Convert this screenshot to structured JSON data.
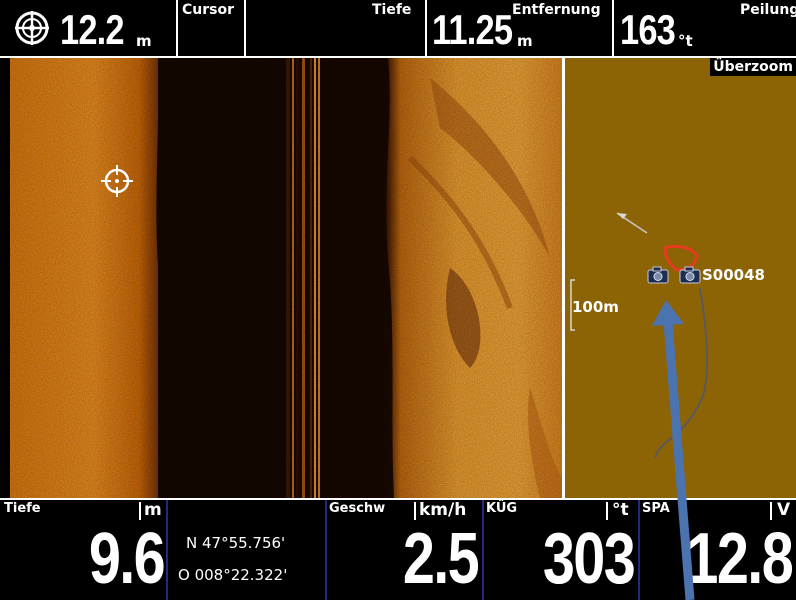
{
  "topbar": {
    "depth_value": "12.2",
    "depth_unit": "m",
    "cursor_label": "Cursor",
    "tiefe_label": "Tiefe",
    "cursor_depth_value": "11.25",
    "cursor_depth_unit": "m",
    "entfernung_label": "Entfernung",
    "bearing_value": "163",
    "bearing_unit": "°t",
    "peilung_label": "Peilung"
  },
  "map": {
    "overzoom_label": "Überzoom",
    "scale_label": "100m",
    "waypoint_label": "S00048",
    "colors": {
      "land": "#8c6406",
      "track": "#5a5a5a",
      "boat": "#e53b1f"
    }
  },
  "bottombar": {
    "depth": {
      "label": "Tiefe",
      "unit": "m",
      "value": "9.6"
    },
    "position": {
      "lat": "N 47°55.756'",
      "lon": "O 008°22.322'"
    },
    "speed": {
      "label": "Geschw",
      "unit": "km/h",
      "value": "2.5"
    },
    "cog": {
      "label": "KÜG",
      "unit": "°t",
      "value": "303"
    },
    "voltage": {
      "label": "SPA",
      "unit": "V",
      "value": "12.8"
    }
  },
  "icons": {
    "cursor_crosshair": "crosshair-icon",
    "waypoint": "camera-icon",
    "pointer_annotation": "blue-arrow-icon"
  }
}
